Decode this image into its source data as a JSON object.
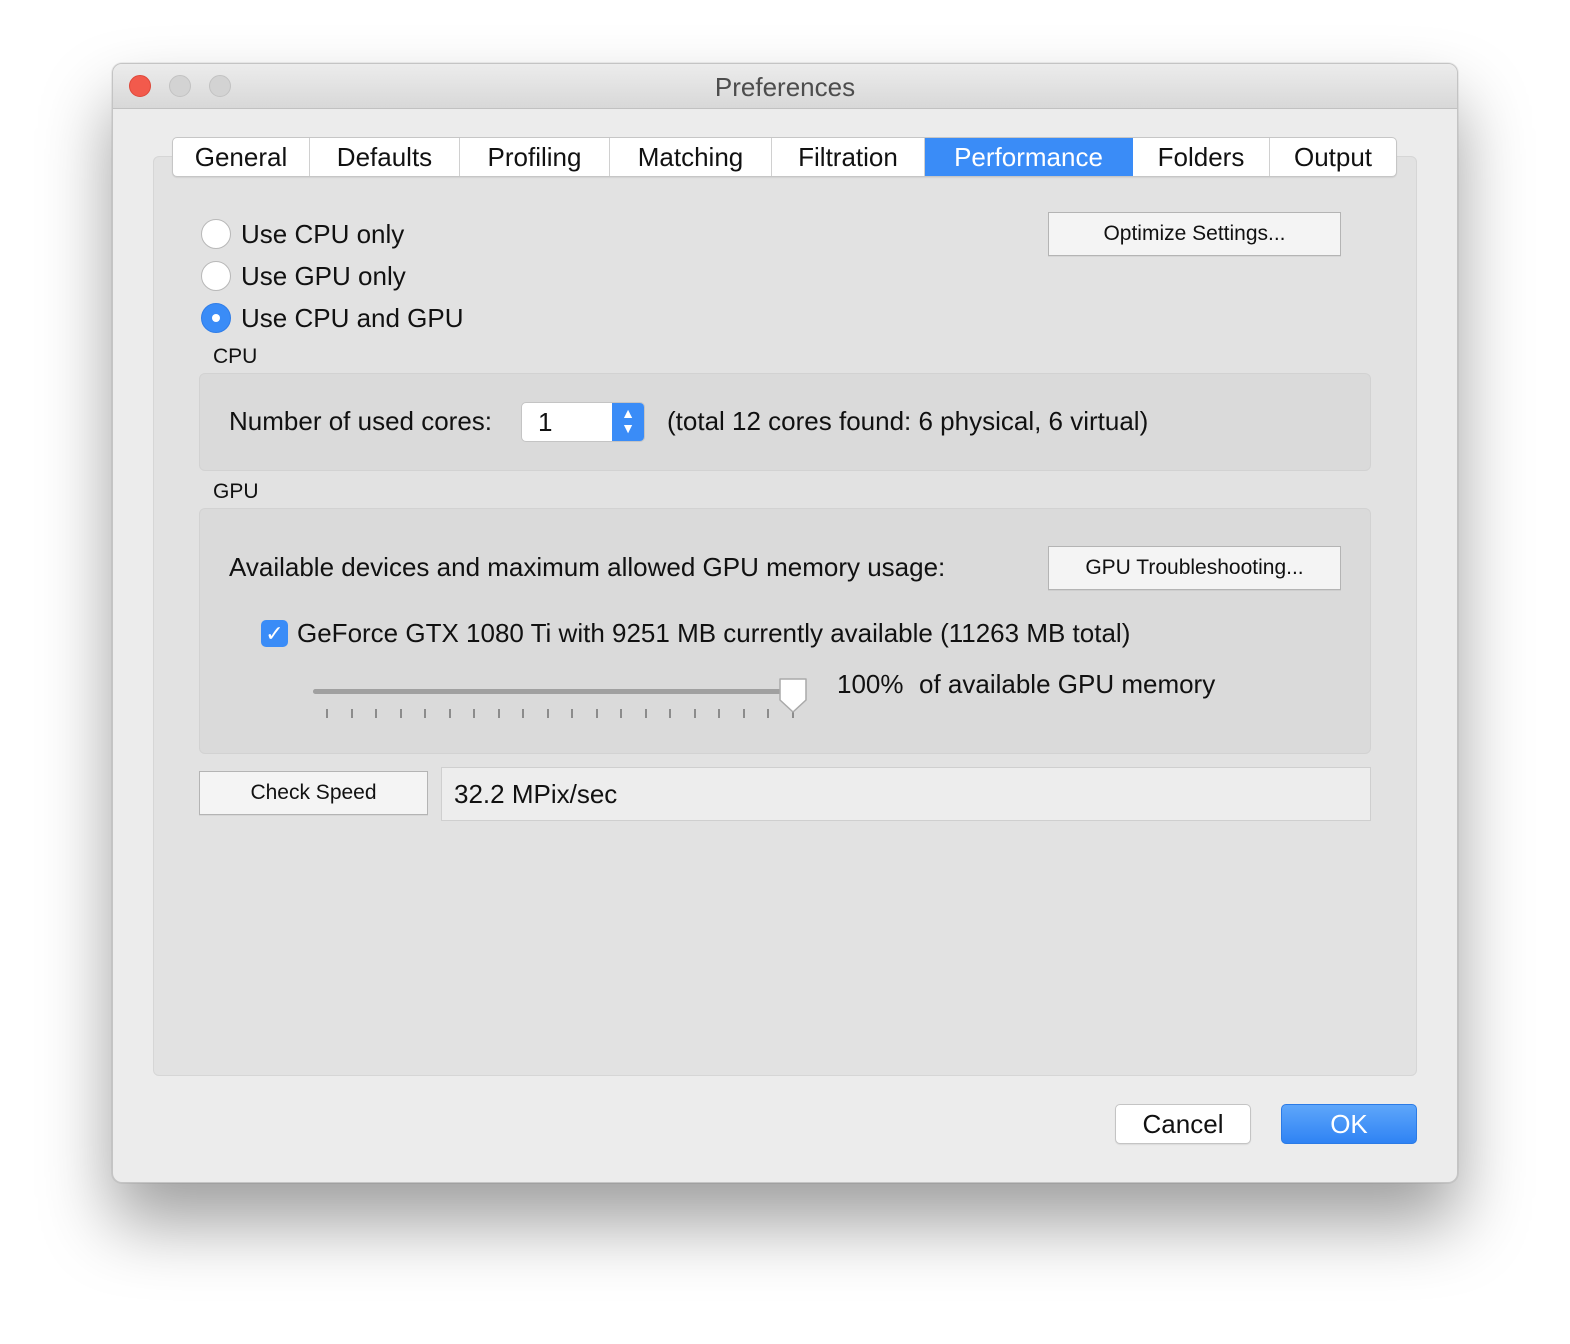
{
  "window": {
    "title": "Preferences"
  },
  "tabs": [
    {
      "label": "General"
    },
    {
      "label": "Defaults"
    },
    {
      "label": "Profiling"
    },
    {
      "label": "Matching"
    },
    {
      "label": "Filtration"
    },
    {
      "label": "Performance",
      "active": true
    },
    {
      "label": "Folders"
    },
    {
      "label": "Output"
    }
  ],
  "mode": {
    "options": [
      {
        "label": "Use CPU only",
        "selected": false
      },
      {
        "label": "Use GPU only",
        "selected": false
      },
      {
        "label": "Use CPU and GPU",
        "selected": true
      }
    ],
    "optimize_button": "Optimize Settings..."
  },
  "cpu": {
    "section_label": "CPU",
    "cores_label": "Number of used cores:",
    "cores_value": "1",
    "cores_info": "(total 12 cores found: 6 physical, 6 virtual)"
  },
  "gpu": {
    "section_label": "GPU",
    "devices_label": "Available devices and maximum allowed GPU memory usage:",
    "troubleshoot_button": "GPU Troubleshooting...",
    "device": {
      "label": "GeForce GTX 1080 Ti with 9251 MB currently available (11263 MB total)",
      "checked": true
    },
    "memory_percent": 100,
    "memory_percent_label": "100%",
    "memory_suffix": "of available GPU memory"
  },
  "speed": {
    "button": "Check Speed",
    "result": "32.2 MPix/sec"
  },
  "footer": {
    "cancel": "Cancel",
    "ok": "OK"
  },
  "colors": {
    "accent": "#3a8cf7",
    "close_light": "#f25a4c"
  }
}
